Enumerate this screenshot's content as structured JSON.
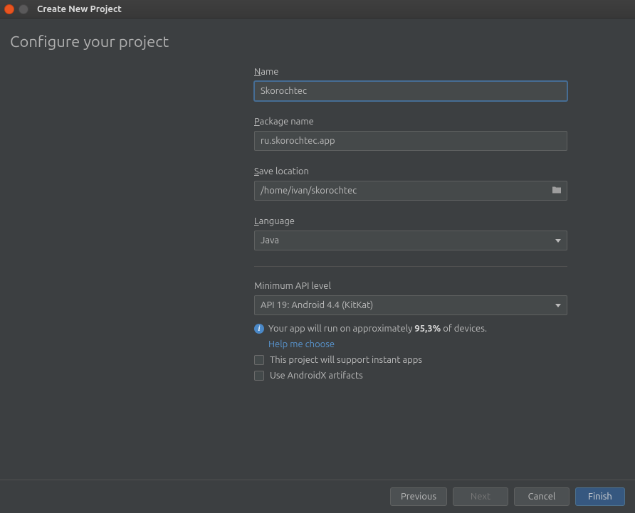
{
  "window": {
    "title": "Create New Project"
  },
  "page": {
    "title": "Configure your project"
  },
  "form": {
    "name": {
      "mnemonic": "N",
      "rest": "ame",
      "value": "Skorochtec"
    },
    "package": {
      "mnemonic": "P",
      "rest": "ackage name",
      "value": "ru.skorochtec.app"
    },
    "saveLocation": {
      "mnemonic": "S",
      "rest": "ave location",
      "value": "/home/ivan/skorochtec"
    },
    "language": {
      "mnemonic": "L",
      "rest": "anguage",
      "value": "Java"
    },
    "minApi": {
      "label": "Minimum API level",
      "value": "API 19: Android 4.4 (KitKat)",
      "info_pre": "Your app will run on approximately ",
      "info_bold": "95,3%",
      "info_post": " of devices.",
      "help": "Help me choose"
    },
    "instantApps": {
      "label": "This project will support instant apps"
    },
    "androidx": {
      "label": "Use AndroidX artifacts"
    }
  },
  "footer": {
    "previous": "Previous",
    "next": "Next",
    "cancel": "Cancel",
    "finish": "Finish"
  }
}
